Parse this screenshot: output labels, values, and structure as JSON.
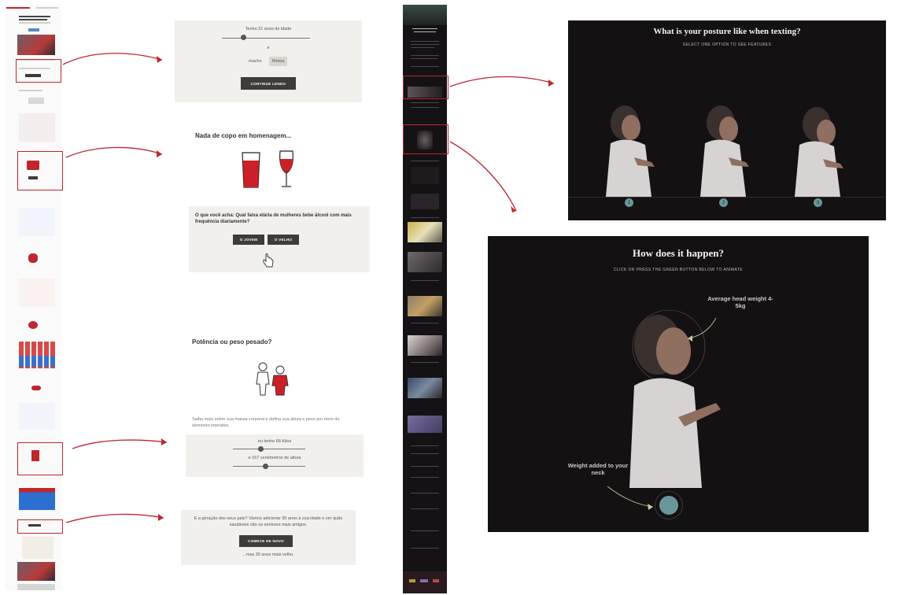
{
  "panel_age": {
    "age_label": "Tenho 21 anos de idade",
    "connector": "e",
    "option_male": "macho",
    "option_female": "fêmea",
    "continue_button": "CONTINUE LENDO"
  },
  "panel_glass": {
    "title": "Nada de copo em homenagem...",
    "question": "O que você acha: Qual faixa etária de mulheres bebe álcool com mais frequência diariamente?",
    "button_a": "O JOVEM",
    "button_b": "O VELHO"
  },
  "panel_weight": {
    "title": "Potência ou peso pesado?",
    "description": "Saiba mais sobre sua massa corporal e defina sua altura e peso por meio do elemento interativo.",
    "weight_label": "eu tenho 68 Kilos",
    "height_label": "e 167 centímetros de altura"
  },
  "panel_restart": {
    "text": "E a geração dos seus pais? Vamos adicionar 30 anos à sua idade e ver quão saudáveis são os seniores mais antigos.",
    "button": "COMECE DE NOVO",
    "footer": "...mas 30 anos mais velho."
  },
  "posture_panel": {
    "title": "What is your posture like when texting?",
    "subtitle": "SELECT ONE OPTION TO SEE FEATURES",
    "options": [
      "1",
      "2",
      "3"
    ],
    "colors": {
      "background": "#141113",
      "accent": "#6a969a"
    }
  },
  "happen_panel": {
    "title": "How does it happen?",
    "subtitle": "CLICK OR PRESS THE GREEN BUTTON BELOW TO ANIMATE",
    "head_label": "Average head weight 4-5kg",
    "neck_label": "Weight added to your neck"
  },
  "theme": {
    "highlight": "#c0262d",
    "button_dark": "#3d3c39",
    "panel_bg": "#f1f0ec"
  }
}
